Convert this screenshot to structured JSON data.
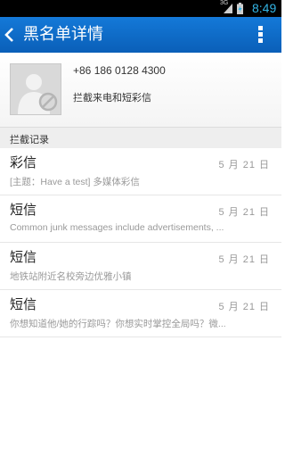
{
  "status_bar": {
    "network": "3G",
    "time": "8:49"
  },
  "title_bar": {
    "title": "黑名单详情",
    "back_icon": "chevron-left-icon",
    "menu_icon": "overflow-menu-icon"
  },
  "contact": {
    "avatar_icon": "blocked-contact-avatar-icon",
    "phone": "+86 186 0128 4300",
    "block_mode": "拦截来电和短彩信"
  },
  "section": {
    "title": "拦截记录"
  },
  "messages": [
    {
      "type": "彩信",
      "date": "5 月 21 日",
      "preview": "[主题：Have a test] 多媒体彩信"
    },
    {
      "type": "短信",
      "date": "5 月 21 日",
      "preview": "Common junk messages include advertisements, ..."
    },
    {
      "type": "短信",
      "date": "5 月 21 日",
      "preview": "地铁站附近名校旁边优雅小镇"
    },
    {
      "type": "短信",
      "date": "5 月 21 日",
      "preview": "你想知道他/她的行踪吗？你想实时掌控全局吗？微..."
    }
  ],
  "colors": {
    "title_bar": "#0a6ccd",
    "status_time": "#33b5e5"
  }
}
